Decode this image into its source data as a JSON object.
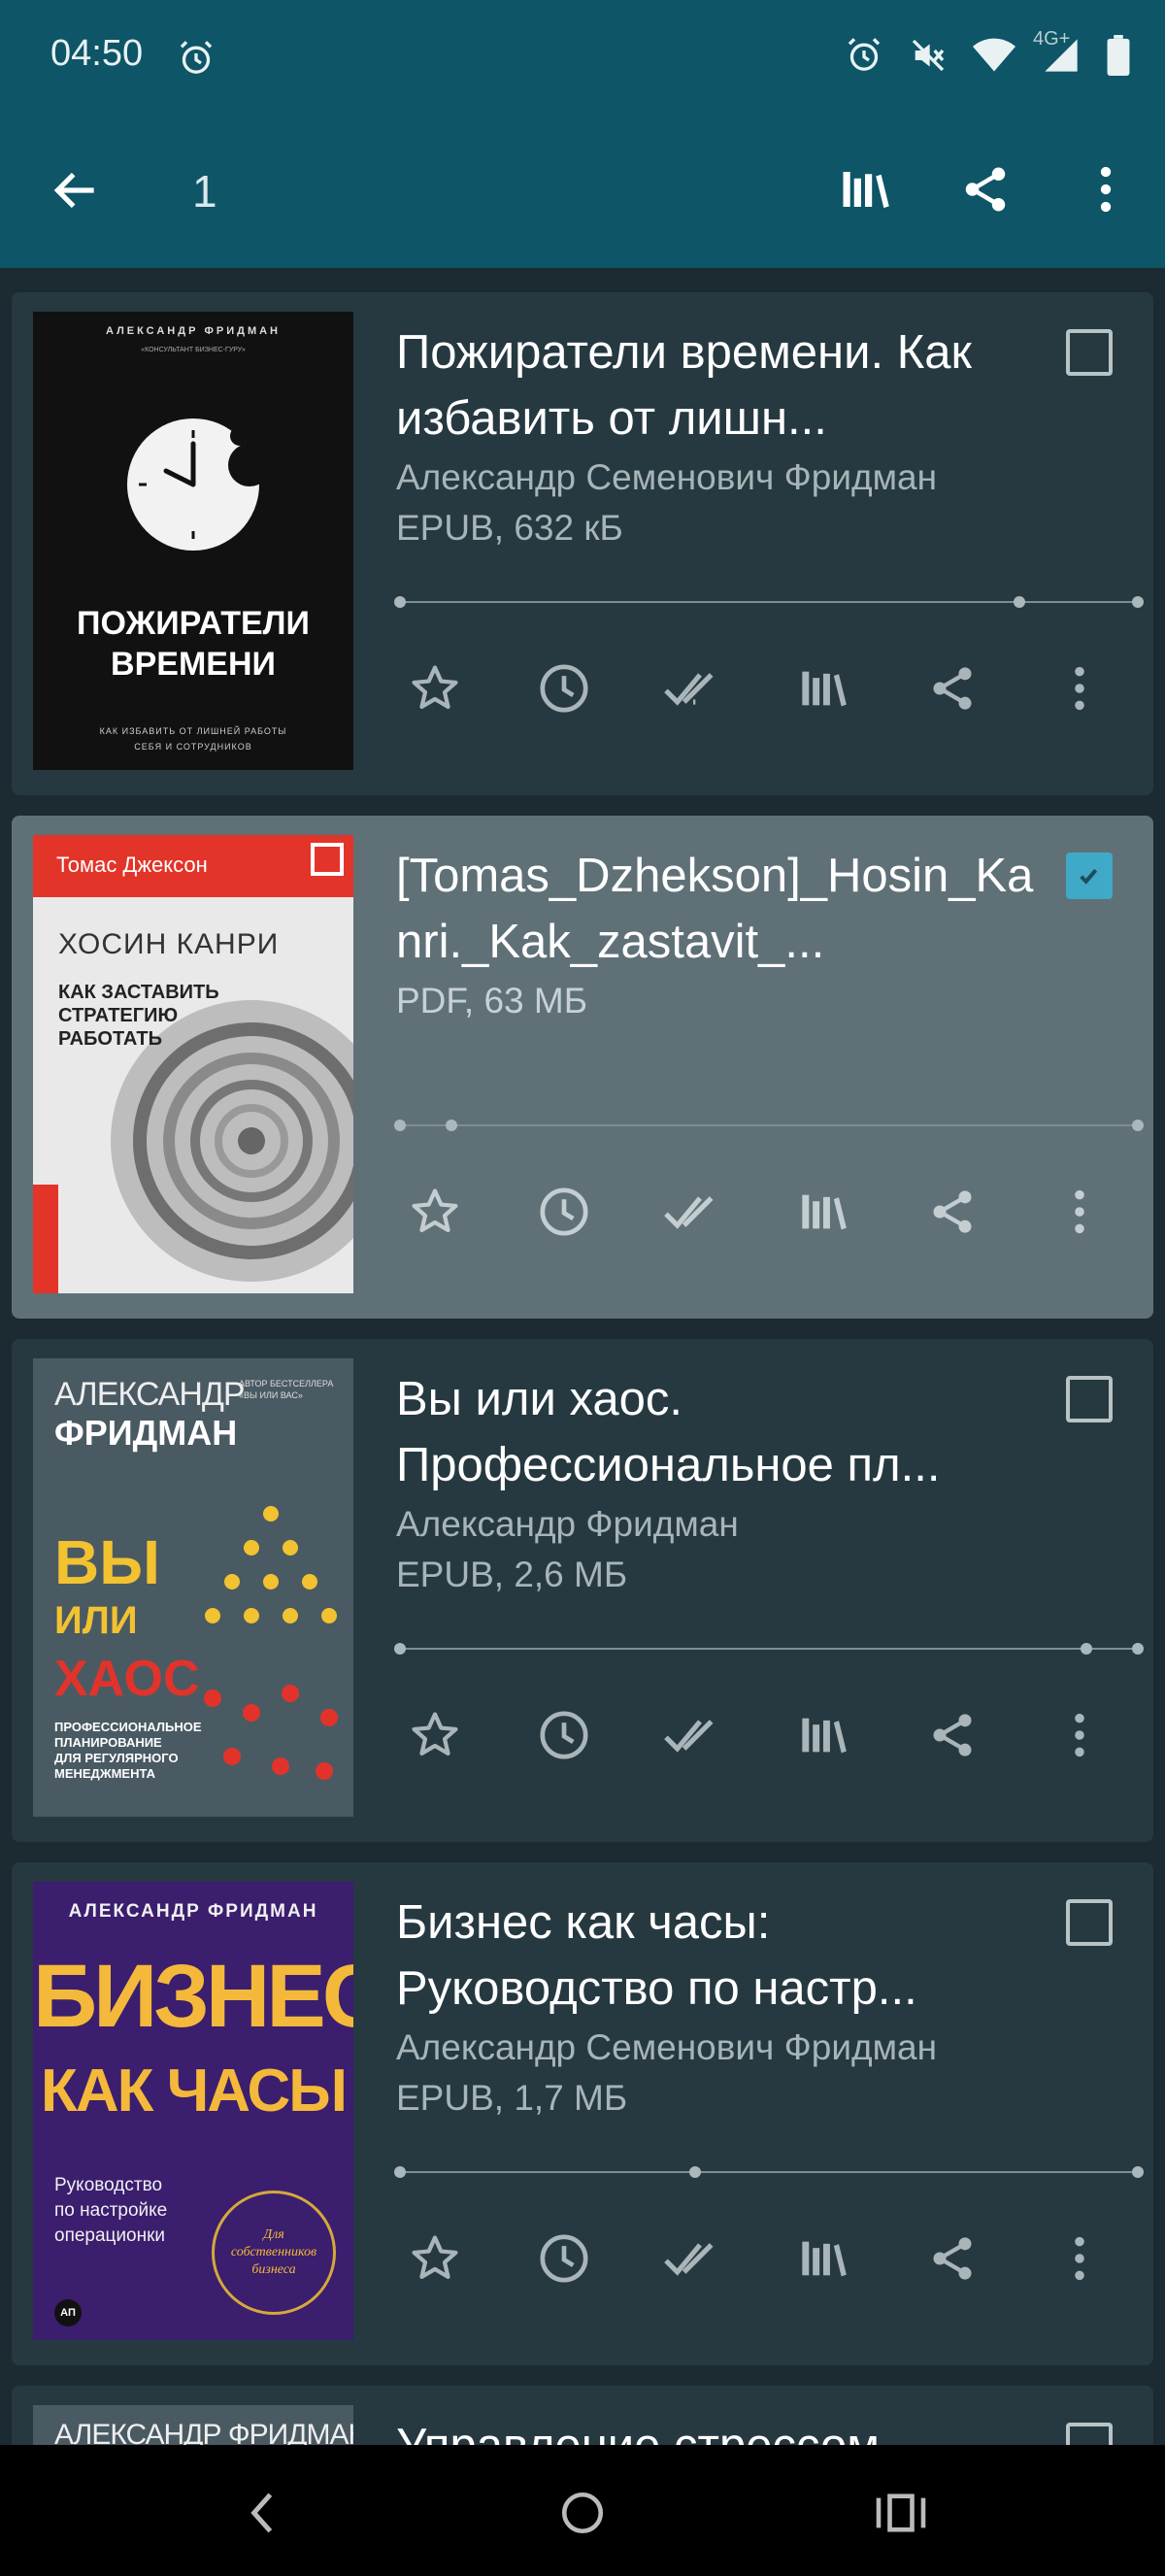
{
  "status_bar": {
    "time": "04:50",
    "network_label": "4G+",
    "icons": [
      "alarm-icon",
      "alarm-icon",
      "mute-icon",
      "wifi-icon",
      "signal-icon",
      "battery-icon"
    ]
  },
  "app_bar": {
    "title": "1",
    "actions": [
      "back-arrow-icon",
      "library-icon",
      "share-icon",
      "more-vert-icon"
    ]
  },
  "books": [
    {
      "title": "Пожиратели времени. Как избавить от лишн...",
      "author": "Александр Семенович Фридман",
      "format": "EPUB, 632 кБ",
      "selected": false,
      "cover": {
        "author": "АЛЕКСАНДР ФРИДМАН",
        "tagline": "«КОНСУЛЬТАНТ БИЗНЕС-ГУРУ»",
        "title_line1": "ПОЖИРАТЕЛИ",
        "title_line2": "ВРЕМЕНИ",
        "subtitle_line1": "КАК ИЗБАВИТЬ ОТ ЛИШНЕЙ РАБОТЫ",
        "subtitle_line2": "СЕБЯ И СОТРУДНИКОВ"
      }
    },
    {
      "title": "[Tomas_Dzhekson]_Hosin_Kanri._Kak_zastavit_...",
      "author": "",
      "format": "PDF, 63 МБ",
      "selected": true,
      "cover": {
        "author": "Томас Джексон",
        "title": "ХОСИН КАНРИ",
        "subtitle_line1": "КАК ЗАСТАВИТЬ",
        "subtitle_line2": "СТРАТЕГИЮ",
        "subtitle_line3": "РАБОТАТЬ"
      }
    },
    {
      "title": "Вы или хаос. Профессиональное пл...",
      "author": "Александр Фридман",
      "format": "EPUB, 2,6 МБ",
      "selected": false,
      "cover": {
        "author_first": "АЛЕКСАНДР",
        "author_last": "ФРИДМАН",
        "badge": "АВТОР БЕСТСЕЛЛЕРА «ВЫ ИЛИ ВАС»",
        "title1": "ВЫ",
        "title2": "ИЛИ",
        "title3": "ХАОС",
        "subtitle_line1": "ПРОФЕССИОНАЛЬНОЕ",
        "subtitle_line2": "ПЛАНИРОВАНИЕ",
        "subtitle_line3": "ДЛЯ РЕГУЛЯРНОГО",
        "subtitle_line4": "МЕНЕДЖМЕНТА"
      }
    },
    {
      "title": "Бизнес как часы: Руководство по настр...",
      "author": "Александр Семенович Фридман",
      "format": "EPUB, 1,7 МБ",
      "selected": false,
      "cover": {
        "author": "АЛЕКСАНДР ФРИДМАН",
        "title1": "БИЗНЕС",
        "title2": "КАК ЧАСЫ",
        "subtitle_line1": "Руководство",
        "subtitle_line2": "по настройке",
        "subtitle_line3": "операционки",
        "seal_line1": "Для",
        "seal_line2": "собственников",
        "seal_line3": "бизнеса",
        "publisher_mark": "АП"
      }
    },
    {
      "title": "Управление стрессом",
      "author": "",
      "format": "",
      "selected": false,
      "cover": {
        "author": "АЛЕКСАНДР ФРИДМАН"
      }
    }
  ],
  "progress": [
    {
      "markers": [
        0.0,
        0.84,
        1.0
      ]
    },
    {
      "markers": [
        0.0,
        0.07,
        1.0
      ]
    },
    {
      "markers": [
        0.0,
        0.93,
        1.0
      ]
    },
    {
      "markers": [
        0.0,
        0.4,
        1.0
      ]
    }
  ],
  "card_actions": [
    "favorite-star-icon",
    "recent-clock-icon",
    "read-done-icon",
    "library-icon",
    "share-icon",
    "more-vert-icon"
  ],
  "colors": {
    "app_bar": "#0d5567",
    "background": "#1c2b31",
    "card": "#263940",
    "card_selected": "#5f7177",
    "checkbox_on": "#3fa9c7"
  },
  "nav_bar": [
    "back-nav-icon",
    "home-nav-icon",
    "recents-nav-icon"
  ]
}
